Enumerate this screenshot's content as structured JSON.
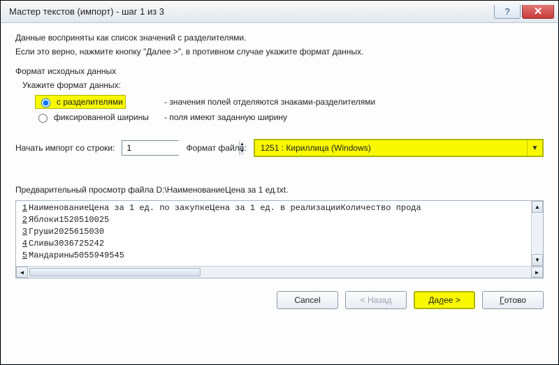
{
  "title": "Мастер текстов (импорт) - шаг 1 из 3",
  "intro1": "Данные восприняты как список значений с разделителями.",
  "intro2": "Если это верно, нажмите кнопку \"Далее >\", в противном случае укажите формат данных.",
  "group_title": "Формат исходных данных",
  "sub_title": "Укажите формат данных:",
  "radio1_label": "с разделителями",
  "radio1_desc": "- значения полей отделяются знаками-разделителями",
  "radio2_label": "фиксированной ширины",
  "radio2_desc": "- поля имеют заданную ширину",
  "radio_selected": 1,
  "start_row_label": "Начать импорт со строки:",
  "start_row_value": "1",
  "file_format_label": "Формат файла:",
  "file_format_value": "1251 : Кириллица (Windows)",
  "preview_label": "Предварительный просмотр файла D:\\НаименованиеЦена за 1 ед.txt.",
  "preview": [
    {
      "n": "1",
      "t": "НаименованиеЦена за 1 ед. по закупкеЦена за 1 ед. в реализацииКоличество прода"
    },
    {
      "n": "2",
      "t": "Яблоки1520510025"
    },
    {
      "n": "3",
      "t": "Груши2025615030"
    },
    {
      "n": "4",
      "t": "Сливы3036725242"
    },
    {
      "n": "5",
      "t": "Мандарины5055949545"
    }
  ],
  "buttons": {
    "cancel": "Cancel",
    "back_full": "< Назад",
    "next_prefix": "Да",
    "next_ul": "л",
    "next_suffix": "ее >",
    "finish_ul": "Г",
    "finish_suffix": "отово"
  }
}
